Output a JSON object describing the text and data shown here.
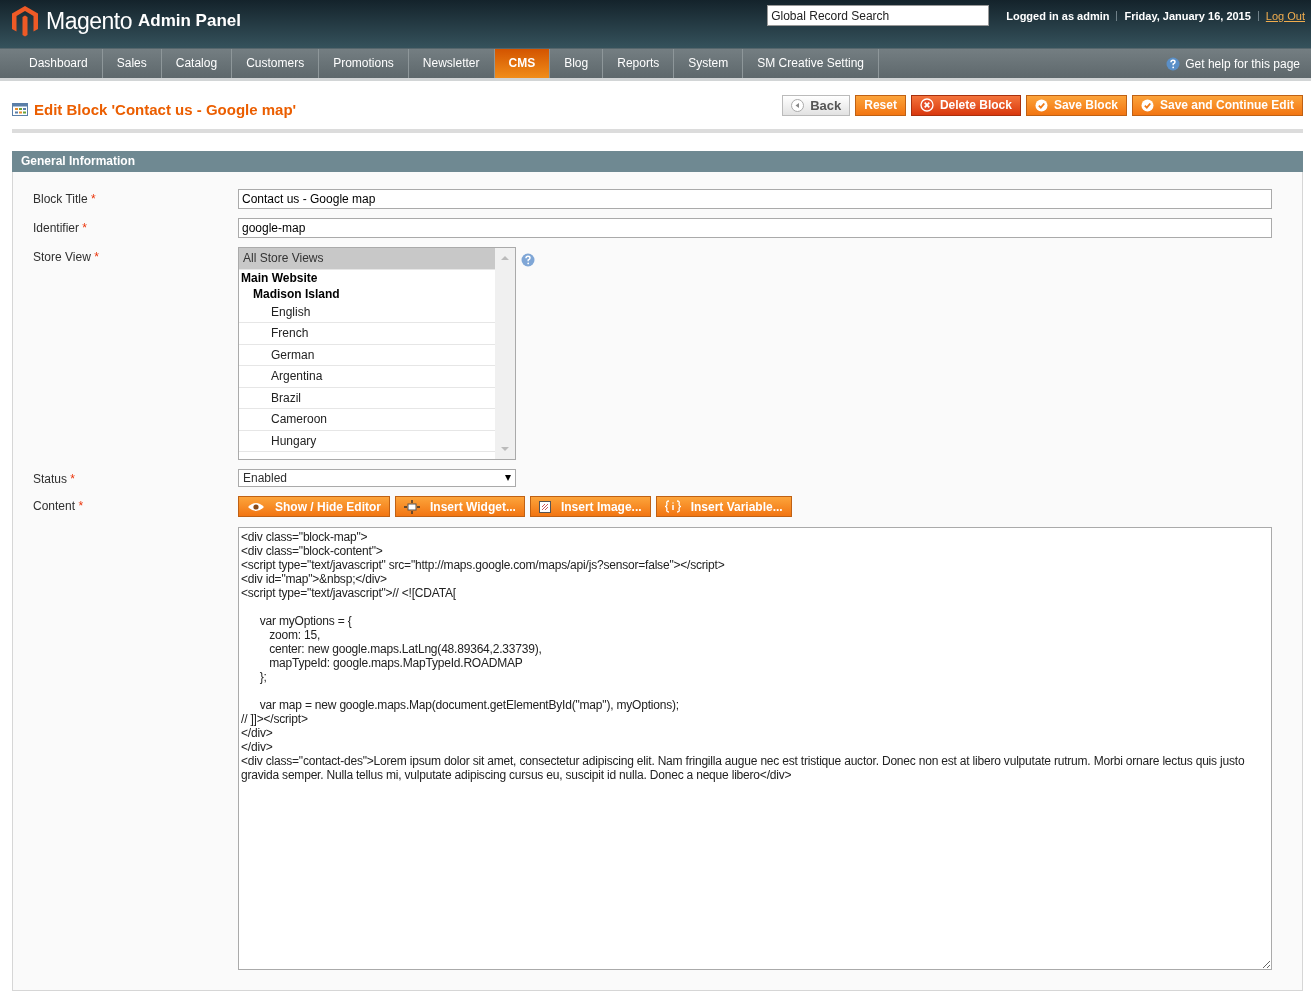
{
  "header": {
    "logo": "Magento",
    "logo_suffix": "Admin Panel",
    "search": {
      "placeholder": "Global Record Search"
    },
    "user": "Logged in as admin",
    "date": "Friday, January 16, 2015",
    "logout": "Log Out"
  },
  "nav": [
    {
      "label": "Dashboard",
      "selected": false
    },
    {
      "label": "Sales",
      "selected": false
    },
    {
      "label": "Catalog",
      "selected": false
    },
    {
      "label": "Customers",
      "selected": false
    },
    {
      "label": "Promotions",
      "selected": false
    },
    {
      "label": "Newsletter",
      "selected": false
    },
    {
      "label": "CMS",
      "selected": true
    },
    {
      "label": "Blog",
      "selected": false
    },
    {
      "label": "Reports",
      "selected": false
    },
    {
      "label": "System",
      "selected": false
    },
    {
      "label": "SM Creative Setting",
      "selected": false
    }
  ],
  "help": "Get help for this page",
  "page_title": "Edit Block 'Contact us - Google map'",
  "actions": [
    {
      "label": "Back",
      "kind": "back"
    },
    {
      "label": "Reset",
      "kind": "plain"
    },
    {
      "label": "Delete Block",
      "kind": "delete"
    },
    {
      "label": "Save Block",
      "kind": "save"
    },
    {
      "label": "Save and Continue Edit",
      "kind": "save"
    }
  ],
  "section": {
    "title": "General Information",
    "fields": [
      {
        "label": "Block Title",
        "required": "*",
        "value": "Contact us - Google map"
      },
      {
        "label": "Identifier",
        "required": "*",
        "value": "google-map"
      }
    ],
    "store_view": {
      "label": "Store View",
      "required": "*",
      "items": [
        {
          "label": "All Store Views",
          "kind": "option",
          "selected": true
        },
        {
          "label": "Main Website",
          "kind": "group",
          "children": [
            {
              "label": "Madison Island",
              "kind": "group",
              "children": [
                {
                  "label": "English",
                  "kind": "option",
                  "selected": false
                },
                {
                  "label": "French",
                  "kind": "option",
                  "selected": false
                },
                {
                  "label": "German",
                  "kind": "option",
                  "selected": false
                },
                {
                  "label": "Argentina",
                  "kind": "option",
                  "selected": false
                },
                {
                  "label": "Brazil",
                  "kind": "option",
                  "selected": false
                },
                {
                  "label": "Cameroon",
                  "kind": "option",
                  "selected": false
                },
                {
                  "label": "Hungary",
                  "kind": "option",
                  "selected": false
                }
              ]
            }
          ]
        }
      ]
    },
    "status": {
      "label": "Status",
      "required": "*",
      "value": "Enabled"
    },
    "content": {
      "label": "Content",
      "required": "*",
      "buttons": [
        {
          "label": "Show / Hide Editor",
          "kind": "toggle"
        },
        {
          "label": "Insert Widget...",
          "kind": "widget"
        },
        {
          "label": "Insert Image...",
          "kind": "image"
        },
        {
          "label": "Insert Variable...",
          "kind": "variable"
        }
      ],
      "value": "<div class=\"block-map\">\n<div class=\"block-content\">\n<script type=\"text/javascript\" src=\"http://maps.google.com/maps/api/js?sensor=false\"></script>\n<div id=\"map\">&nbsp;</div>\n<script type=\"text/javascript\">// <![CDATA[\n\n      var myOptions = {\n         zoom: 15,\n         center: new google.maps.LatLng(48.89364,2.33739),\n         mapTypeId: google.maps.MapTypeId.ROADMAP\n      };\n\n      var map = new google.maps.Map(document.getElementById(\"map\"), myOptions);\n// ]]></script>\n</div>\n</div>\n<div class=\"contact-des\">Lorem ipsum dolor sit amet, consectetur adipiscing elit. Nam fringilla augue nec est tristique auctor. Donec non est at libero vulputate rutrum. Morbi ornare lectus quis justo gravida semper. Nulla tellus mi, vulputate adipiscing cursus eu, suscipit id nulla. Donec a neque libero</div>"
    }
  }
}
